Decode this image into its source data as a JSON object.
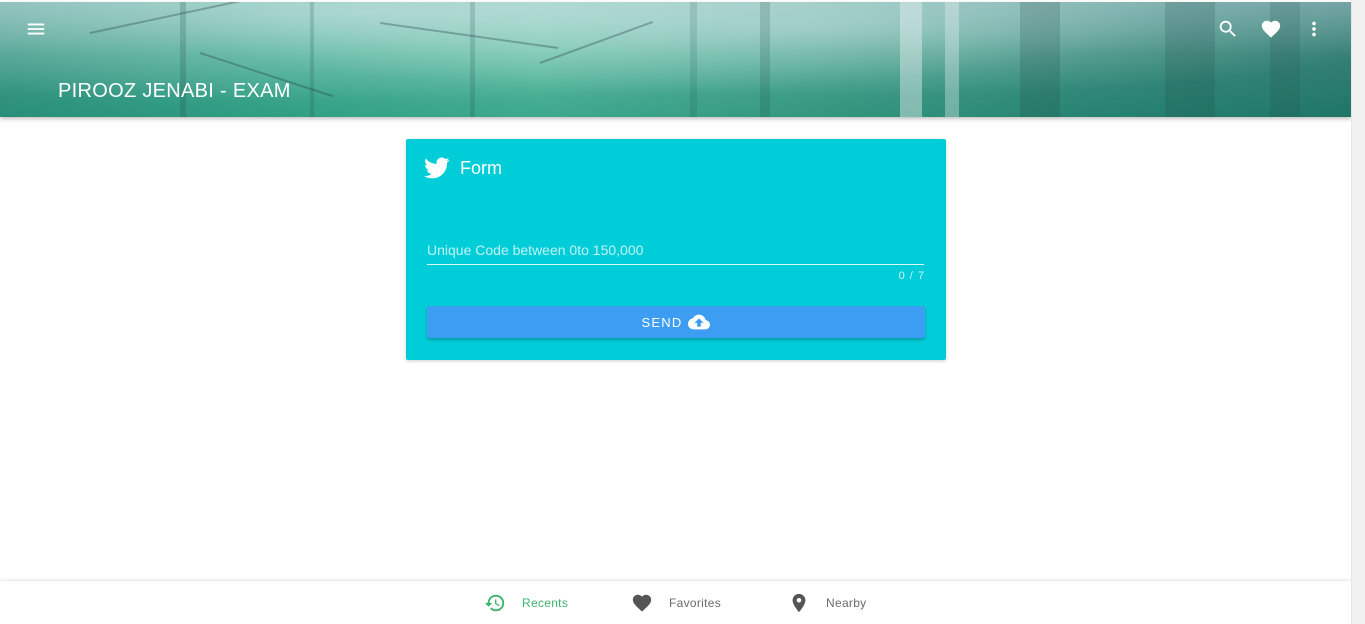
{
  "header": {
    "title": "PIROOZ JENABI - EXAM",
    "menu_icon": "menu-icon",
    "actions": [
      {
        "name": "search-icon"
      },
      {
        "name": "heart-icon"
      },
      {
        "name": "more-vert-icon"
      }
    ]
  },
  "form": {
    "title": "Form",
    "icon": "twitter-icon",
    "code_input": {
      "value": "",
      "placeholder": "Unique Code between 0to 150,000",
      "counter": "0 / 7"
    },
    "send_label": "SEND",
    "send_icon": "cloud-upload-icon"
  },
  "bottom_nav": {
    "items": [
      {
        "label": "Recents",
        "icon": "history-icon",
        "active": true
      },
      {
        "label": "Favorites",
        "icon": "heart-icon",
        "active": false
      },
      {
        "label": "Nearby",
        "icon": "location-pin-icon",
        "active": false
      }
    ]
  },
  "colors": {
    "card": "#00cdd8",
    "button": "#3d9df2",
    "active_nav": "#3bb56c",
    "header_teal": "#3aa88f"
  }
}
